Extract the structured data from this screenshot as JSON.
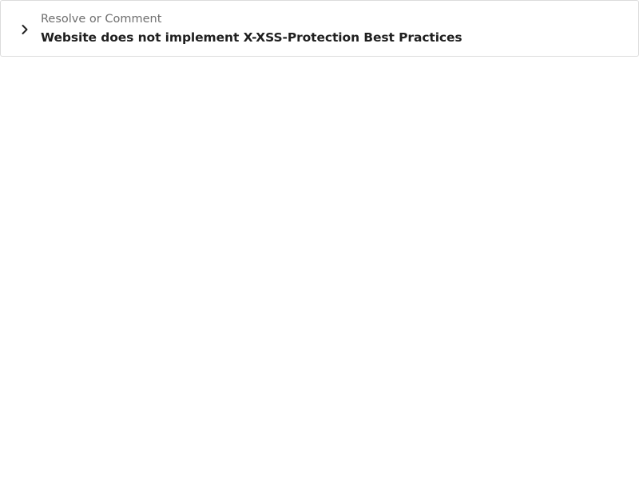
{
  "panel": {
    "subtitle": "Resolve or Comment",
    "title": "Website does not implement X-XSS-Protection Best Practices",
    "expand_icon": "chevron-right-icon"
  },
  "colors": {
    "border": "#dcdcdc",
    "subtitle_text": "#6f6f6f",
    "title_text": "#1f1f1f",
    "background": "#ffffff"
  }
}
